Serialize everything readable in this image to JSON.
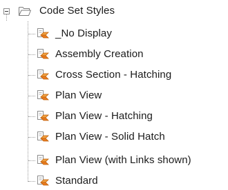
{
  "tree": {
    "root": {
      "label": "Code Set Styles",
      "icon": "folder-open-icon",
      "expanded": true
    },
    "children": [
      {
        "label": "_No Display",
        "icon": "code-set-style-icon"
      },
      {
        "label": "Assembly Creation",
        "icon": "code-set-style-icon"
      },
      {
        "label": "Cross Section - Hatching",
        "icon": "code-set-style-icon"
      },
      {
        "label": "Plan View",
        "icon": "code-set-style-icon"
      },
      {
        "label": "Plan View - Hatching",
        "icon": "code-set-style-icon"
      },
      {
        "label": "Plan View - Solid Hatch",
        "icon": "code-set-style-icon"
      },
      {
        "label": "Plan View (with Links shown)",
        "icon": "code-set-style-icon"
      },
      {
        "label": "Standard",
        "icon": "code-set-style-icon"
      }
    ]
  },
  "colors": {
    "guide_line": "#9a9a9a",
    "icon_accent": "#e87a1e",
    "icon_gray": "#7d7d7d",
    "text": "#1a1a1a"
  }
}
